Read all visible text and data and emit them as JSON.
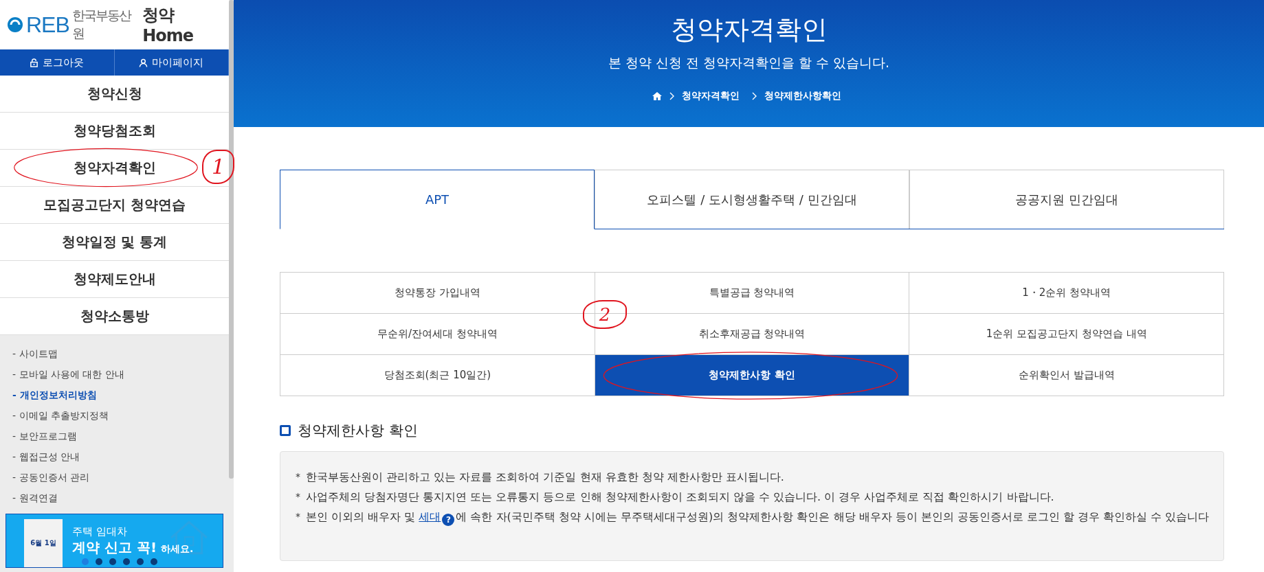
{
  "logo": {
    "mark": "REB",
    "org": "한국부동산원",
    "service": "청약",
    "service_suffix": "Home"
  },
  "account_buttons": [
    {
      "kind": "lock",
      "label": "로그아웃"
    },
    {
      "kind": "person",
      "label": "마이페이지"
    }
  ],
  "menu": [
    {
      "label": "청약신청",
      "circled": false
    },
    {
      "label": "청약당첨조회",
      "circled": false
    },
    {
      "label": "청약자격확인",
      "circled": true,
      "mark": "1"
    },
    {
      "label": "모집공고단지 청약연습",
      "circled": false
    },
    {
      "label": "청약일정 및 통계",
      "circled": false
    },
    {
      "label": "청약제도안내",
      "circled": false
    },
    {
      "label": "청약소통방",
      "circled": false
    }
  ],
  "footer_links": [
    {
      "label": "- 사이트맵",
      "selected": false
    },
    {
      "label": "- 모바일 사용에 대한 안내",
      "selected": false
    },
    {
      "label": "- 개인정보처리방침",
      "selected": true
    },
    {
      "label": "- 이메일 추출방지정책",
      "selected": false
    },
    {
      "label": "- 보안프로그램",
      "selected": false
    },
    {
      "label": "- 웹접근성 안내",
      "selected": false
    },
    {
      "label": "- 공동인증서 관리",
      "selected": false
    },
    {
      "label": "- 원격연결",
      "selected": false
    }
  ],
  "banner": {
    "doc_date": "6월 1일",
    "line1": "주택 임대차",
    "line2": "계약 신고 꼭!",
    "line2_tail": "하세요.",
    "dots": [
      {
        "selected": true
      },
      {
        "selected": false
      },
      {
        "selected": false
      },
      {
        "selected": false
      },
      {
        "selected": false
      },
      {
        "selected": false
      }
    ]
  },
  "header": {
    "title": "청약자격확인",
    "subtitle": "본 청약 신청 전 청약자격확인을 할 수 있습니다.",
    "breadcrumb": [
      "청약자격확인",
      "청약제한사항확인"
    ]
  },
  "tabs": [
    {
      "label": "APT",
      "selected": true
    },
    {
      "label": "오피스텔 / 도시형생활주택 / 민간임대",
      "selected": false
    },
    {
      "label": "공공지원 민간임대",
      "selected": false
    }
  ],
  "tiles": [
    {
      "label": "청약통장 가입내역",
      "selected": false,
      "circled": false
    },
    {
      "label": "특별공급 청약내역",
      "selected": false,
      "circled": false
    },
    {
      "label": "1・2순위 청약내역",
      "selected": false,
      "circled": false
    },
    {
      "label": "무순위/잔여세대 청약내역",
      "selected": false,
      "circled": false
    },
    {
      "label": "취소후재공급 청약내역",
      "selected": false,
      "circled": false,
      "mark": "2"
    },
    {
      "label": "1순위 모집공고단지 청약연습 내역",
      "selected": false,
      "circled": false
    },
    {
      "label": "당첨조회(최근 10일간)",
      "selected": false,
      "circled": false
    },
    {
      "label": "청약제한사항 확인",
      "selected": true,
      "circled": true
    },
    {
      "label": "순위확인서 발급내역",
      "selected": false,
      "circled": false
    }
  ],
  "section": {
    "title": "청약제한사항 확인",
    "notes": [
      {
        "text": "한국부동산원이 관리하고 있는 자료를 조회하여 기준일 현재 유효한 청약 제한사항만 표시됩니다."
      },
      {
        "text": "사업주체의 당첨자명단 통지지연 또는 오류통지 등으로 인해 청약제한사항이 조회되지 않을 수 있습니다. 이 경우 사업주체로 직접 확인하시기 바랍니다."
      },
      {
        "text": "본인 이외의 배우자 및",
        "link": "세대",
        "after": "에 속한 자(국민주택 청약 시에는 무주택세대구성원)의 청약제한사항 확인은 해당 배우자 등이 본인의 공동인증서로 로그인 할 경우 확인하실 수 있습니다"
      }
    ],
    "bullet": "*",
    "help_glyph": "?"
  }
}
